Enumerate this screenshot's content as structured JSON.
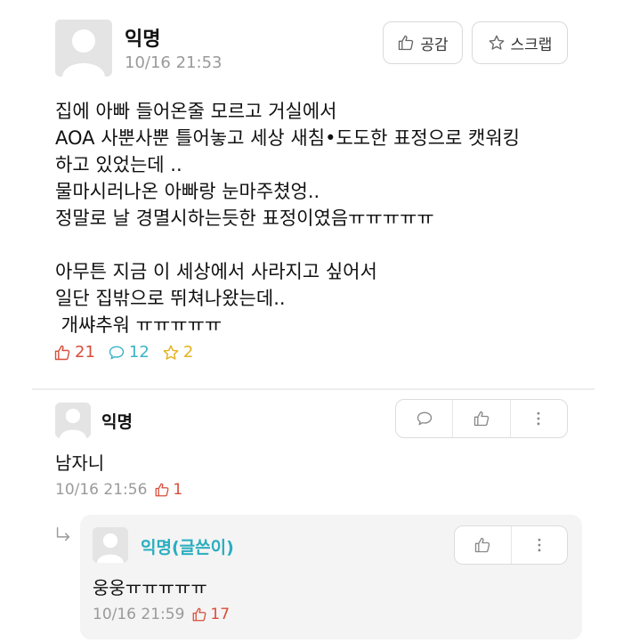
{
  "post": {
    "author": "익명",
    "time": "10/16 21:53",
    "like_button": "공감",
    "scrap_button": "스크랩",
    "body_lines": [
      "집에 아빠 들어온줄 모르고 거실에서",
      "AOA 사뿐사뿐 틀어놓고 세상 새침•도도한 표정으로 캣워킹",
      "하고 있었는데 ..",
      "물마시러나온 아빠랑 눈마주쳤엉..",
      "정말로 날 경멸시하는듯한 표정이였음ㅠㅠㅠㅠㅠ",
      "",
      "아무튼 지금 이 세상에서 사라지고 싶어서",
      "일단 집밖으로 뛰쳐나왔는데..",
      " 개쌰추워 ㅠㅠㅠㅠㅠ"
    ],
    "stats": {
      "likes": "21",
      "comments": "12",
      "scraps": "2"
    }
  },
  "comment": {
    "author": "익명",
    "text": "남자니",
    "time": "10/16 21:56",
    "likes": "1"
  },
  "reply": {
    "author": "익명(글쓴이)",
    "text": "웅웅ㅠㅠㅠㅠㅠ",
    "time": "10/16 21:59",
    "likes": "17"
  },
  "colors": {
    "like": "#d94d3a",
    "comment": "#3bb3c8",
    "scrap": "#e3b21c",
    "writer": "#2aaec0"
  },
  "icons": [
    "avatar-placeholder-icon",
    "thumbs-up-icon",
    "star-icon",
    "speech-bubble-icon",
    "more-vertical-icon",
    "reply-arrow-icon"
  ]
}
